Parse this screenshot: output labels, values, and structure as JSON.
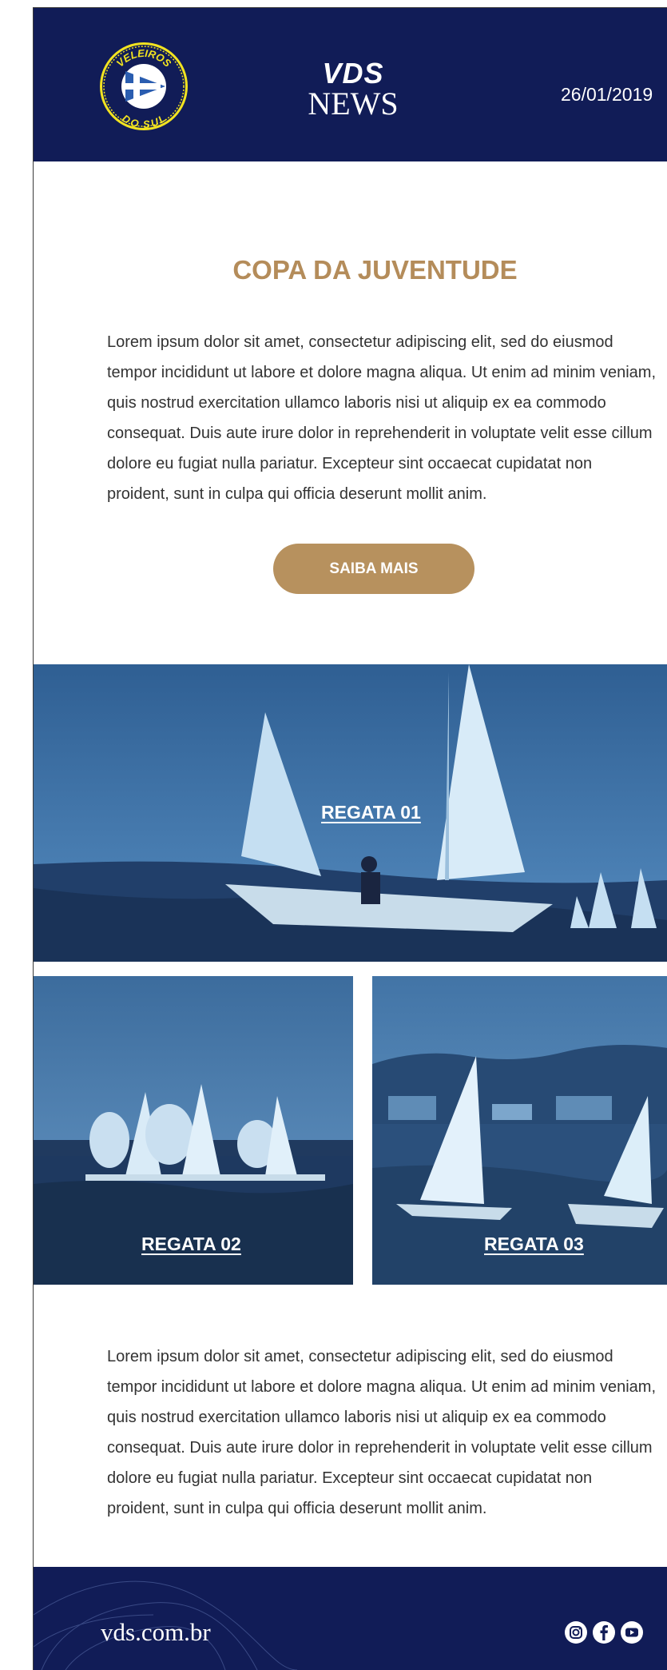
{
  "header": {
    "logo_top_text": "VELEIROS",
    "logo_bottom_text": "DO SUL",
    "brand_line1": "VDS",
    "brand_line2": "NEWS",
    "date": "26/01/2019"
  },
  "article": {
    "title": "COPA DA JUVENTUDE",
    "paragraph": "Lorem ipsum dolor sit amet, consectetur adipiscing elit, sed do eiusmod tempor incididunt ut labore et dolore magna aliqua. Ut enim ad minim veniam, quis nostrud exercitation ullamco laboris nisi ut aliquip ex ea commodo consequat. Duis aute irure dolor in reprehenderit in voluptate velit esse cillum dolore eu fugiat nulla pariatur. Excepteur sint occaecat cupidatat non proident, sunt in culpa qui officia deserunt mollit anim.",
    "cta_label": "SAIBA MAIS"
  },
  "gallery": [
    {
      "label": "REGATA 01"
    },
    {
      "label": "REGATA 02"
    },
    {
      "label": "REGATA 03"
    }
  ],
  "second_paragraph": "Lorem ipsum dolor sit amet, consectetur adipiscing elit, sed do eiusmod tempor incididunt ut labore et dolore magna aliqua. Ut enim ad minim veniam, quis nostrud exercitation ullamco laboris nisi ut aliquip ex ea commodo consequat. Duis aute irure dolor in reprehenderit in voluptate velit esse cillum dolore eu fugiat nulla pariatur. Excepteur sint occaecat cupidatat non proident, sunt in culpa qui officia deserunt mollit anim.",
  "footer": {
    "site": "vds.com.br",
    "social_icons": [
      "instagram-icon",
      "facebook-icon",
      "youtube-icon"
    ]
  },
  "colors": {
    "navy": "#111c57",
    "gold": "#b48c5a",
    "button": "#b7915e",
    "logo_yellow": "#f2e320",
    "photo_tint": "#3d6d9c"
  }
}
